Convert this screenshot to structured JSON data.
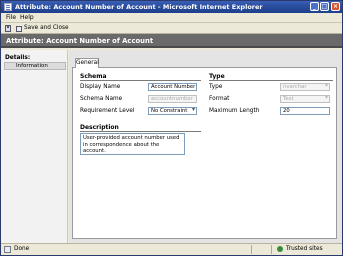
{
  "window": {
    "title": "Attribute: Account Number of Account - Microsoft Internet Explorer",
    "min_glyph": "_",
    "max_glyph": "□",
    "close_glyph": "×"
  },
  "menu": {
    "file": "File",
    "help": "Help"
  },
  "toolbar": {
    "save_and_close": "Save and Close"
  },
  "page": {
    "title": "Attribute: Account Number of Account"
  },
  "sidebar": {
    "heading": "Details:",
    "items": [
      {
        "label": "Information"
      }
    ]
  },
  "tabs": [
    {
      "label": "General"
    }
  ],
  "schema": {
    "title": "Schema",
    "display_name_label": "Display Name",
    "display_name_value": "Account Number",
    "schema_name_label": "Schema Name",
    "schema_name_value": "accountnumber",
    "requirement_label": "Requirement Level",
    "requirement_value": "No Constraint"
  },
  "type": {
    "title": "Type",
    "type_label": "Type",
    "type_value": "nvarchar",
    "format_label": "Format",
    "format_value": "Text",
    "max_length_label": "Maximum Length",
    "max_length_value": "20"
  },
  "description": {
    "title": "Description",
    "value": "User-provided account number used in correspondence about the account."
  },
  "status": {
    "text": "Done",
    "zone": "Trusted sites"
  }
}
